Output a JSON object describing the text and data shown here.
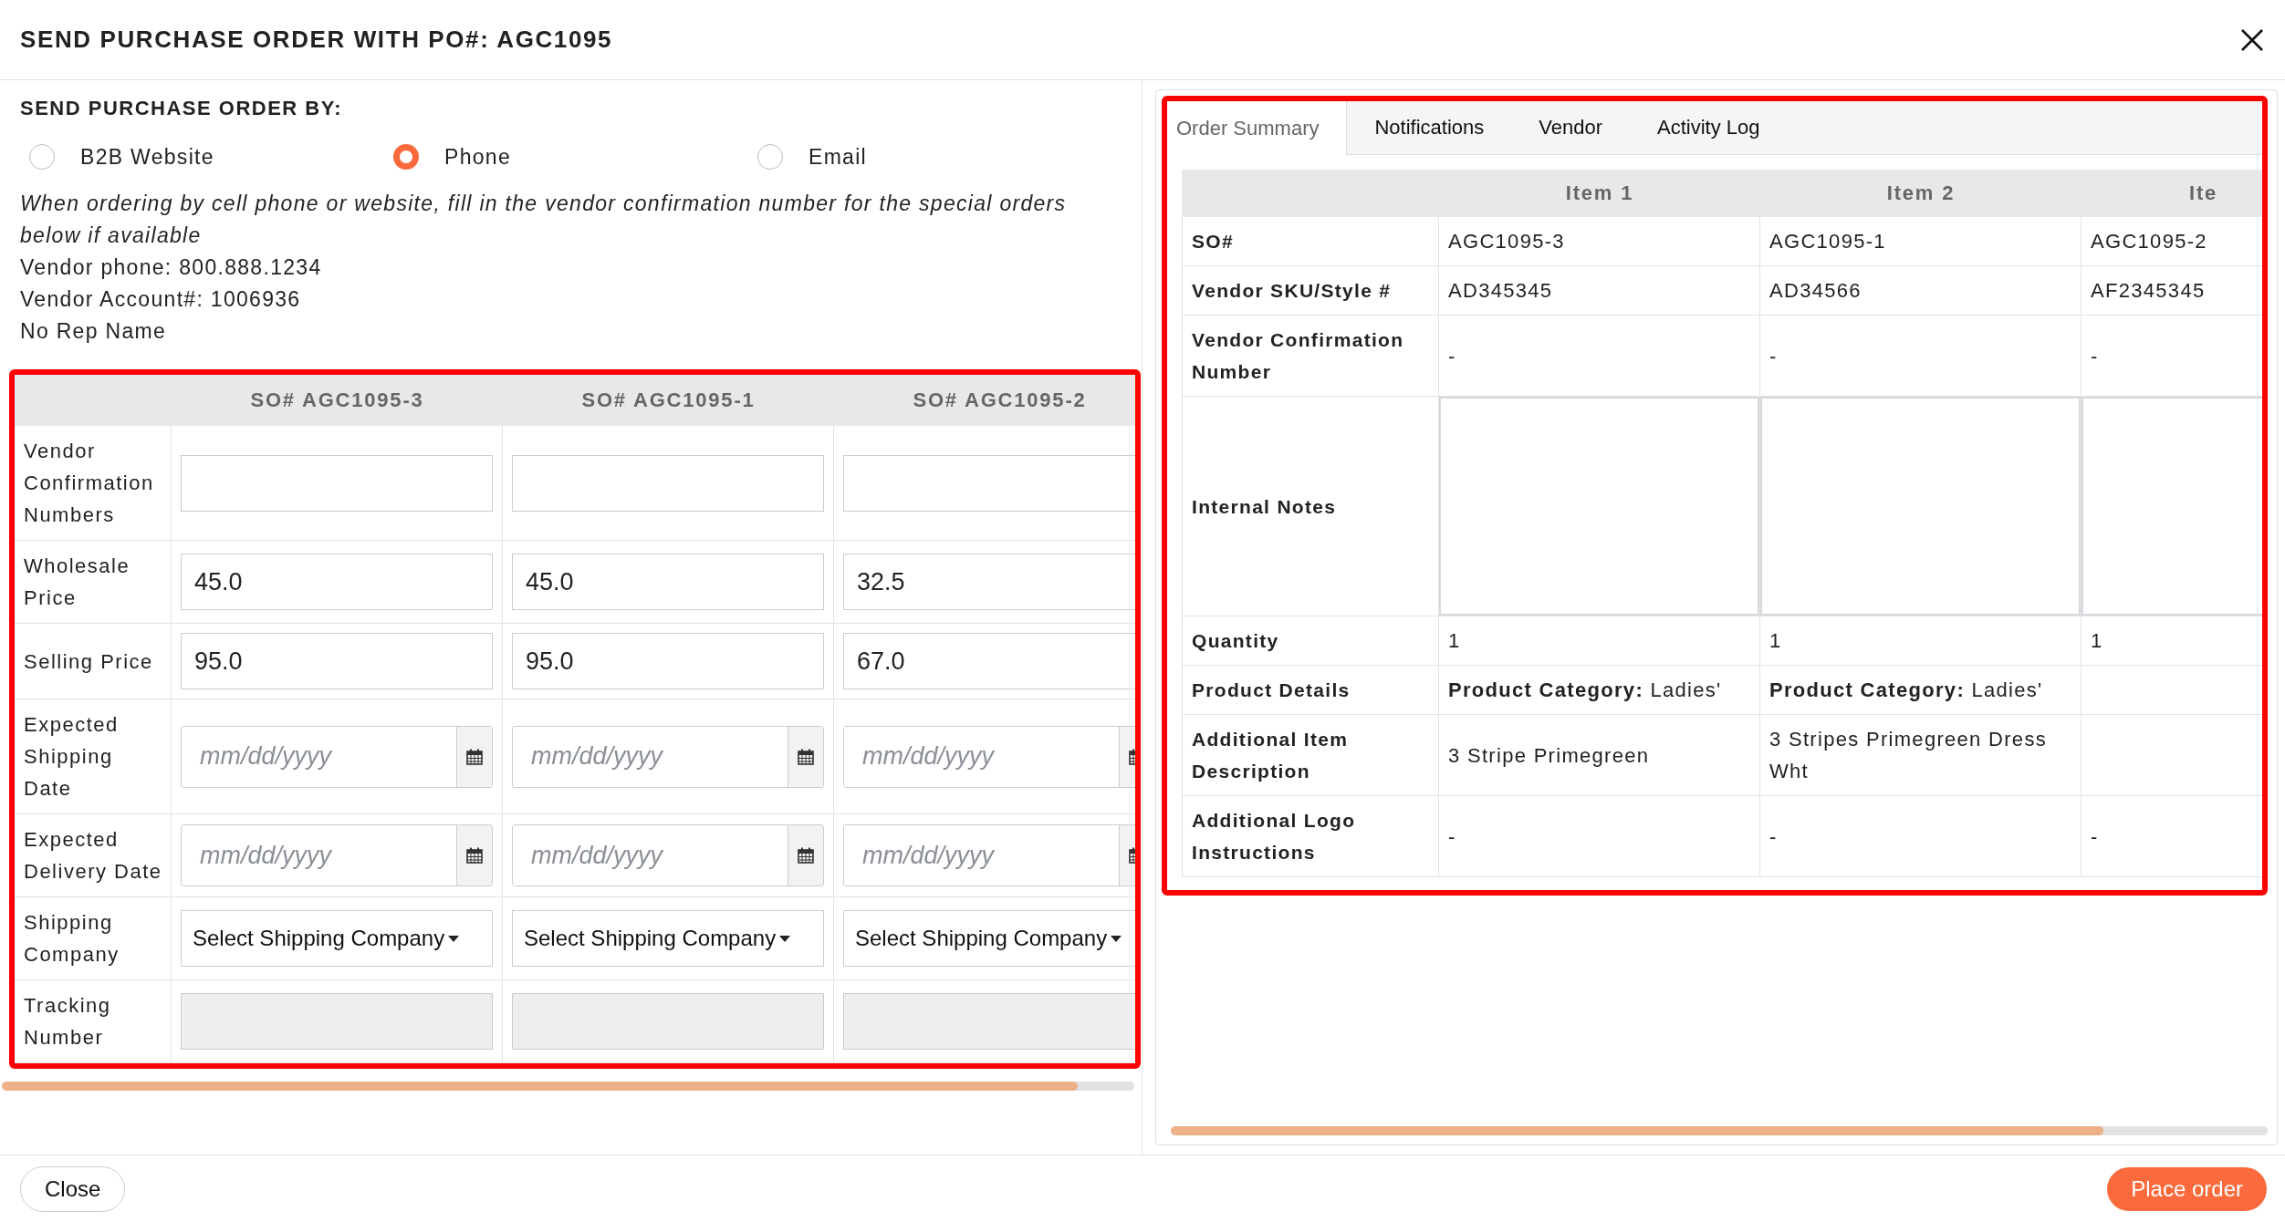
{
  "dialog": {
    "title": "SEND PURCHASE ORDER WITH PO#: AGC1095"
  },
  "send_by": {
    "heading": "SEND PURCHASE ORDER BY:",
    "options": [
      {
        "label": "B2B Website",
        "selected": false
      },
      {
        "label": "Phone",
        "selected": true
      },
      {
        "label": "Email",
        "selected": false
      }
    ],
    "note": "When ordering by cell phone or website, fill in the vendor confirmation number for the special orders below if available",
    "details": [
      "Vendor phone: 800.888.1234",
      "Vendor Account#: 1006936",
      "No Rep Name"
    ]
  },
  "special_orders": {
    "highlighted": true,
    "rows": [
      {
        "label": "Vendor Confirmation Numbers",
        "kind": "text"
      },
      {
        "label": "Wholesale Price",
        "kind": "text"
      },
      {
        "label": "Selling Price",
        "kind": "text"
      },
      {
        "label": "Expected Shipping Date",
        "kind": "date"
      },
      {
        "label": "Expected Delivery Date",
        "kind": "date"
      },
      {
        "label": "Shipping Company",
        "kind": "select"
      },
      {
        "label": "Tracking Number",
        "kind": "text"
      }
    ],
    "columns": [
      {
        "heading": "SO# AGC1095-3",
        "cells": [
          {
            "disabled": false
          },
          {
            "value": "45.0",
            "disabled": false
          },
          {
            "value": "95.0",
            "disabled": false
          },
          {
            "placeholder": "mm/dd/yyyy",
            "disabled": false
          },
          {
            "placeholder": "mm/dd/yyyy",
            "disabled": false
          },
          {
            "value": "Select Shipping Company",
            "disabled": false
          },
          {
            "disabled": true
          }
        ]
      },
      {
        "heading": "SO# AGC1095-1",
        "cells": [
          {
            "disabled": false
          },
          {
            "value": "45.0",
            "disabled": false
          },
          {
            "value": "95.0",
            "disabled": false
          },
          {
            "placeholder": "mm/dd/yyyy",
            "disabled": false
          },
          {
            "placeholder": "mm/dd/yyyy",
            "disabled": false
          },
          {
            "value": "Select Shipping Company",
            "disabled": false
          },
          {
            "disabled": true
          }
        ]
      },
      {
        "heading": "SO# AGC1095-2",
        "cells": [
          {
            "disabled": false
          },
          {
            "value": "32.5",
            "disabled": false
          },
          {
            "value": "67.0",
            "disabled": false
          },
          {
            "placeholder": "mm/dd/yyyy",
            "disabled": false
          },
          {
            "placeholder": "mm/dd/yyyy",
            "disabled": false
          },
          {
            "value": "Select Shipping Company",
            "disabled": false
          },
          {
            "disabled": true
          }
        ]
      }
    ]
  },
  "summary": {
    "highlighted": true,
    "tabs": [
      {
        "label": "Order Summary",
        "selected": true
      },
      {
        "label": "Notifications",
        "selected": false
      },
      {
        "label": "Vendor",
        "selected": false
      },
      {
        "label": "Activity Log",
        "selected": false
      }
    ],
    "columns": [
      "Item 1",
      "Item 2",
      "Ite"
    ],
    "rows": [
      {
        "label": "SO#",
        "kind": "text",
        "cells": [
          {
            "text": "AGC1095-3"
          },
          {
            "text": "AGC1095-1"
          },
          {
            "text": "AGC1095-2"
          }
        ]
      },
      {
        "label": "Vendor SKU/Style #",
        "kind": "text",
        "cells": [
          {
            "text": "AD345345"
          },
          {
            "text": "AD34566"
          },
          {
            "text": "AF2345345"
          }
        ]
      },
      {
        "label": "Vendor Confirmation Number",
        "kind": "text",
        "cells": [
          {
            "text": "-"
          },
          {
            "text": "-"
          },
          {
            "text": "-"
          }
        ]
      },
      {
        "label": "Internal Notes",
        "kind": "notes",
        "cells": [
          {},
          {},
          {}
        ]
      },
      {
        "label": "Quantity",
        "kind": "text",
        "cells": [
          {
            "text": "1"
          },
          {
            "text": "1"
          },
          {
            "text": "1"
          }
        ]
      },
      {
        "label": "Product Details",
        "kind": "text",
        "cells": [
          {
            "text": "**Product Category:** Ladies'"
          },
          {
            "text": "**Product Category:** Ladies'"
          },
          {}
        ]
      },
      {
        "label": "Additional Item Description",
        "kind": "text",
        "cells": [
          {
            "text": "3 Stripe Primegreen"
          },
          {
            "text": "3 Stripes Primegreen Dress Wht"
          },
          {}
        ]
      },
      {
        "label": "Additional Logo Instructions",
        "kind": "text",
        "cells": [
          {
            "text": "-"
          },
          {
            "text": "-"
          },
          {
            "text": "-"
          }
        ]
      }
    ]
  },
  "footer": {
    "buttons": [
      {
        "label": "Close",
        "kind": "secondary"
      },
      {
        "label": "Place order",
        "kind": "primary"
      }
    ]
  }
}
